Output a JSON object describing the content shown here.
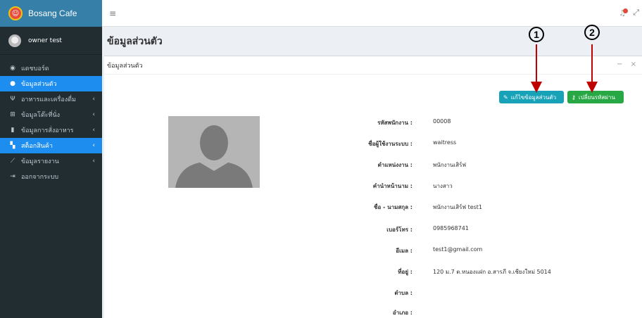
{
  "brand": {
    "name": "Bosang Cafe"
  },
  "user": {
    "name": "owner test"
  },
  "sidebar": {
    "items": [
      {
        "label": "แดชบอร์ด",
        "icon": "dashboard-icon",
        "active": false,
        "chev": ""
      },
      {
        "label": "ข้อมูลส่วนตัว",
        "icon": "user-icon",
        "active": true,
        "chev": ""
      },
      {
        "label": "อาหารและเครื่องดื่ม",
        "icon": "utensils-icon",
        "active": false,
        "chev": "‹"
      },
      {
        "label": "ข้อมูลโต๊ะที่นั่ง",
        "icon": "table-icon",
        "active": false,
        "chev": "‹"
      },
      {
        "label": "ข้อมูลการสั่งอาหาร",
        "icon": "clipboard-icon",
        "active": false,
        "chev": "‹"
      },
      {
        "label": "สต็อกสินค้า",
        "icon": "cubes-icon",
        "active": true,
        "chev": "‹"
      },
      {
        "label": "ข้อมูลรายงาน",
        "icon": "chart-icon",
        "active": false,
        "chev": "‹"
      },
      {
        "label": "ออกจากระบบ",
        "icon": "signout-icon",
        "active": false,
        "chev": ""
      }
    ]
  },
  "page": {
    "title": "ข้อมูลส่วนตัว",
    "box_title": "ข้อมูลส่วนตัว"
  },
  "buttons": {
    "edit": "แก้ไขข้อมูลส่วนตัว",
    "password": "เปลี่ยนรหัสผ่าน"
  },
  "annotations": {
    "one": "1",
    "two": "2"
  },
  "profile": {
    "fields": [
      {
        "label": "รหัสพนักงาน :",
        "value": "00008"
      },
      {
        "label": "ชื่อผู้ใช้งานระบบ :",
        "value": "waitress"
      },
      {
        "label": "ตำแหน่งงาน :",
        "value": "พนักงานเสิร์ฟ"
      },
      {
        "label": "คำนำหน้านาม :",
        "value": "นางสาว"
      },
      {
        "label": "ชื่อ - นามสกุล :",
        "value": "พนักงานเสิร์ฟ   test1"
      },
      {
        "label": "เบอร์โทร :",
        "value": "0985968741"
      },
      {
        "label": "อีเมล :",
        "value": "test1@gmail.com"
      },
      {
        "label": "ที่อยู่ :",
        "value": "120 ม.7 ต.หนองแฝก อ.สารภี จ.เชียงใหม่ 5014"
      },
      {
        "label": "ตำบล :",
        "value": ""
      },
      {
        "label": "อำเภอ :",
        "value": ""
      }
    ]
  },
  "colors": {
    "sidebar": "#222d32",
    "brand": "#367fa9",
    "active": "#1e8df0",
    "edit": "#17a2b8",
    "pass": "#28a745",
    "arrow": "#c00000"
  }
}
